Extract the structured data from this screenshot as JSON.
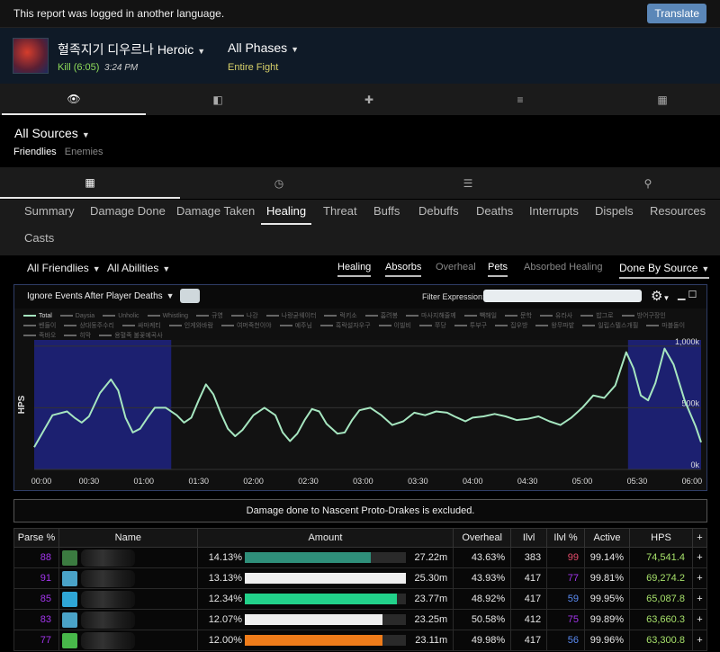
{
  "banner": {
    "message": "This report was logged in another language.",
    "translate_label": "Translate"
  },
  "fight": {
    "boss_name": "혈족지기 디우르나 Heroic",
    "kill_label": "Kill (6:05)",
    "kill_time": "3:24 PM",
    "phase": "All Phases",
    "phase_sub": "Entire Fight"
  },
  "nav_tabs": [
    {
      "icon": "eye-icon",
      "glyph": "👁"
    },
    {
      "icon": "compare-icon",
      "glyph": "◧"
    },
    {
      "icon": "puzzle-icon",
      "glyph": "✚"
    },
    {
      "icon": "sort-icon",
      "glyph": "≡"
    },
    {
      "icon": "film-icon",
      "glyph": "▦"
    }
  ],
  "sources": {
    "label": "All Sources",
    "friendlies": "Friendlies",
    "enemies": "Enemies"
  },
  "view_tabs": [
    {
      "icon": "table-icon",
      "glyph": "▦"
    },
    {
      "icon": "clock-icon",
      "glyph": "◷"
    },
    {
      "icon": "list-icon",
      "glyph": "☰"
    },
    {
      "icon": "map-pin-icon",
      "glyph": "⚲"
    }
  ],
  "metric_tabs": [
    "Summary",
    "Damage Done",
    "Damage Taken",
    "Healing",
    "Threat",
    "Buffs",
    "Debuffs",
    "Deaths",
    "Interrupts",
    "Dispels",
    "Resources",
    "Casts"
  ],
  "filters": {
    "friendlies": "All Friendlies",
    "abilities": "All Abilities",
    "opt_healing": "Healing",
    "opt_absorbs": "Absorbs",
    "opt_overheal": "Overheal",
    "opt_pets": "Pets",
    "opt_absorbed": "Absorbed Healing",
    "done_by": "Done By Source"
  },
  "graph": {
    "ignore_label": "Ignore Events After Player Deaths",
    "filter_label": "Filter Expression:",
    "legend": [
      "Total",
      "Daysia",
      "Unholic",
      "Whistling",
      "규영",
      "나강",
      "나랑굳웨이터",
      "럭키소",
      "흠려봉",
      "마사지해줄께",
      "빽해일",
      "문학",
      "유라사",
      "밥그로",
      "방어구장인",
      "벤들이",
      "상대둥주수리",
      "싸마케티",
      "인게와바람",
      "여머죽천이야",
      "예주님",
      "흑락설자우구",
      "이빌비",
      "쭈당",
      "투부구",
      "집우방",
      "왕무파밭",
      "일립스텔스개필",
      "마블돌이",
      "족바오",
      "히막",
      "용혈족 불꽃예곡사"
    ]
  },
  "chart_data": {
    "type": "line",
    "title": "",
    "xlabel": "",
    "ylabel": "HPS",
    "x_ticks": [
      "00:00",
      "00:30",
      "01:00",
      "01:30",
      "02:00",
      "02:30",
      "03:00",
      "03:30",
      "04:00",
      "04:30",
      "05:00",
      "05:30",
      "06:00"
    ],
    "y_ticks": [
      "0k",
      "500k",
      "1,000k"
    ],
    "ylim": [
      0,
      1050000
    ],
    "xlim": [
      0,
      365
    ],
    "series": [
      {
        "name": "Total",
        "color": "#a6e6c0",
        "points": [
          [
            0,
            180000
          ],
          [
            10,
            440000
          ],
          [
            18,
            470000
          ],
          [
            22,
            420000
          ],
          [
            26,
            380000
          ],
          [
            30,
            430000
          ],
          [
            36,
            620000
          ],
          [
            42,
            730000
          ],
          [
            46,
            640000
          ],
          [
            50,
            420000
          ],
          [
            54,
            300000
          ],
          [
            58,
            330000
          ],
          [
            62,
            420000
          ],
          [
            66,
            500000
          ],
          [
            72,
            500000
          ],
          [
            78,
            440000
          ],
          [
            82,
            380000
          ],
          [
            86,
            420000
          ],
          [
            90,
            560000
          ],
          [
            94,
            690000
          ],
          [
            98,
            610000
          ],
          [
            102,
            460000
          ],
          [
            106,
            330000
          ],
          [
            110,
            270000
          ],
          [
            114,
            320000
          ],
          [
            120,
            440000
          ],
          [
            126,
            500000
          ],
          [
            132,
            440000
          ],
          [
            136,
            300000
          ],
          [
            140,
            230000
          ],
          [
            144,
            290000
          ],
          [
            148,
            400000
          ],
          [
            152,
            490000
          ],
          [
            156,
            470000
          ],
          [
            160,
            370000
          ],
          [
            166,
            290000
          ],
          [
            170,
            300000
          ],
          [
            174,
            400000
          ],
          [
            178,
            480000
          ],
          [
            184,
            500000
          ],
          [
            190,
            440000
          ],
          [
            196,
            360000
          ],
          [
            202,
            390000
          ],
          [
            208,
            460000
          ],
          [
            214,
            440000
          ],
          [
            220,
            470000
          ],
          [
            226,
            460000
          ],
          [
            230,
            430000
          ],
          [
            236,
            390000
          ],
          [
            240,
            420000
          ],
          [
            246,
            430000
          ],
          [
            252,
            450000
          ],
          [
            258,
            430000
          ],
          [
            264,
            400000
          ],
          [
            270,
            410000
          ],
          [
            276,
            430000
          ],
          [
            282,
            390000
          ],
          [
            288,
            360000
          ],
          [
            294,
            420000
          ],
          [
            300,
            500000
          ],
          [
            306,
            600000
          ],
          [
            312,
            580000
          ],
          [
            318,
            680000
          ],
          [
            324,
            950000
          ],
          [
            328,
            820000
          ],
          [
            332,
            600000
          ],
          [
            336,
            560000
          ],
          [
            340,
            700000
          ],
          [
            345,
            980000
          ],
          [
            350,
            850000
          ],
          [
            356,
            560000
          ],
          [
            362,
            350000
          ],
          [
            365,
            220000
          ]
        ]
      }
    ],
    "highlight_regions": [
      [
        0,
        75
      ],
      [
        325,
        365
      ]
    ],
    "grid": true
  },
  "note": "Damage done to Nascent Proto-Drakes is excluded.",
  "table": {
    "headers": [
      "Parse %",
      "Name",
      "Amount",
      "Overheal",
      "Ilvl",
      "Ilvl %",
      "Active",
      "HPS",
      "+"
    ],
    "rows": [
      {
        "parse": "88",
        "pct": "14.13%",
        "fill": 0.7813,
        "bar_color": "#2f8f7a",
        "amount": "27.22m",
        "overheal": "43.63%",
        "ilvl": "383",
        "ilvl_pct": "99",
        "active": "99.14%",
        "hps": "74,541.4",
        "icon_color": "#3b7b40"
      },
      {
        "parse": "91",
        "pct": "13.13%",
        "fill": 1.0,
        "bar_color": "#efefef",
        "amount": "25.30m",
        "overheal": "43.93%",
        "ilvl": "417",
        "ilvl_pct": "77",
        "active": "99.81%",
        "hps": "69,274.2",
        "icon_color": "#4aa3c8"
      },
      {
        "parse": "85",
        "pct": "12.34%",
        "fill": 0.9444,
        "bar_color": "#22d18a",
        "amount": "23.77m",
        "overheal": "48.92%",
        "ilvl": "417",
        "ilvl_pct": "59",
        "active": "99.95%",
        "hps": "65,087.8",
        "icon_color": "#2fa6d6"
      },
      {
        "parse": "83",
        "pct": "12.07%",
        "fill": 0.8556,
        "bar_color": "#efefef",
        "amount": "23.25m",
        "overheal": "50.58%",
        "ilvl": "412",
        "ilvl_pct": "75",
        "active": "99.89%",
        "hps": "63,660.3",
        "icon_color": "#4aa3c8"
      },
      {
        "parse": "77",
        "pct": "12.00%",
        "fill": 0.8556,
        "bar_color": "#f07c1a",
        "amount": "23.11m",
        "overheal": "49.98%",
        "ilvl": "417",
        "ilvl_pct": "56",
        "active": "99.96%",
        "hps": "63,300.8",
        "icon_color": "#48b84a"
      }
    ]
  },
  "colors": {
    "accent": "#5b87b8",
    "chart_line": "#a6e6c0",
    "highlight": "#1c2070",
    "epic": "#a335ee",
    "rare": "#5b8cf5",
    "hps_green": "#a6e06a"
  }
}
